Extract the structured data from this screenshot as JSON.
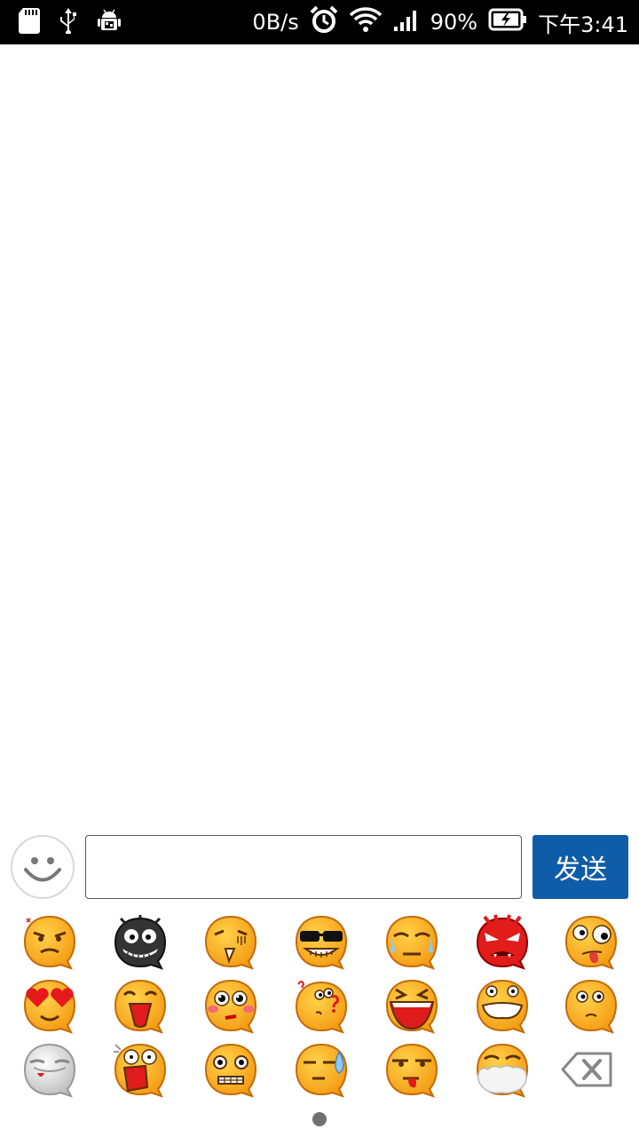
{
  "statusbar": {
    "net_speed": "0B/s",
    "battery_percent": "90%",
    "time": "下午3:41",
    "icons": [
      "sd-card-icon",
      "usb-icon",
      "android-debug-icon",
      "alarm-icon",
      "wifi-icon",
      "signal-icon",
      "battery-charging-icon"
    ]
  },
  "input": {
    "value": "",
    "placeholder": ""
  },
  "send_button": {
    "label": "发送"
  },
  "emoji_panel": {
    "rows": [
      [
        "annoyed",
        "dark-grin",
        "tongue-out",
        "sunglasses",
        "crying",
        "angry-devil",
        "crazy-tongue"
      ],
      [
        "heart-eyes",
        "laughing",
        "blushing",
        "question",
        "big-laugh",
        "grimace",
        "surprised"
      ],
      [
        "ghost-tongue",
        "shocked",
        "scared",
        "sweat",
        "bored-tongue",
        "pale-mask",
        "backspace"
      ]
    ],
    "page": 1
  }
}
